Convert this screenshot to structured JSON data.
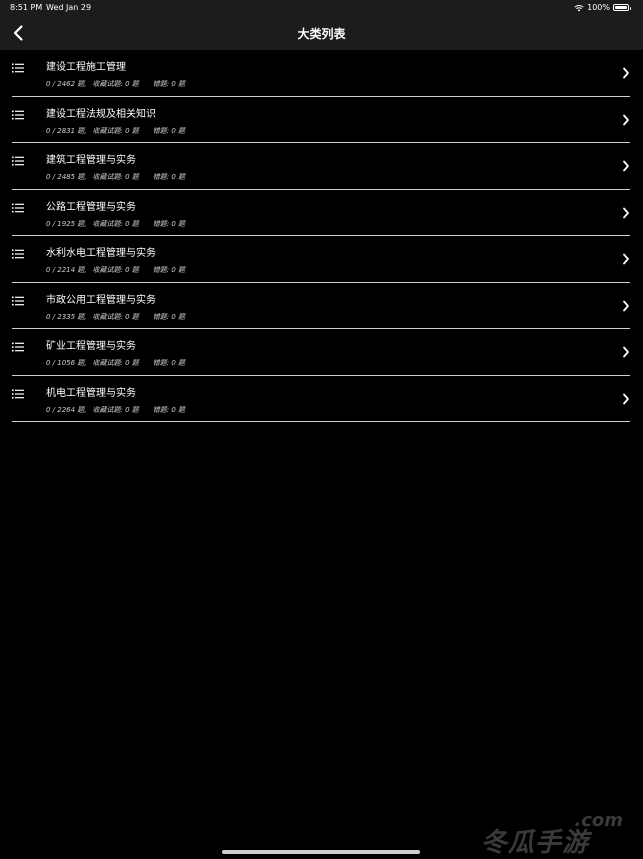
{
  "status_bar": {
    "time": "8:51 PM",
    "date": "Wed Jan 29",
    "battery": "100%"
  },
  "nav": {
    "title": "大类列表"
  },
  "items": [
    {
      "title": "建设工程施工管理",
      "progress": "0 / 2462 题,",
      "favorites": "收藏试题: 0 题",
      "errors": "错题: 0 题"
    },
    {
      "title": "建设工程法规及相关知识",
      "progress": "0 / 2831 题,",
      "favorites": "收藏试题: 0 题",
      "errors": "错题: 0 题"
    },
    {
      "title": "建筑工程管理与实务",
      "progress": "0 / 2485 题,",
      "favorites": "收藏试题: 0 题",
      "errors": "错题: 0 题"
    },
    {
      "title": "公路工程管理与实务",
      "progress": "0 / 1925 题,",
      "favorites": "收藏试题: 0 题",
      "errors": "错题: 0 题"
    },
    {
      "title": "水利水电工程管理与实务",
      "progress": "0 / 2214 题,",
      "favorites": "收藏试题: 0 题",
      "errors": "错题: 0 题"
    },
    {
      "title": "市政公用工程管理与实务",
      "progress": "0 / 2335 题,",
      "favorites": "收藏试题: 0 题",
      "errors": "错题: 0 题"
    },
    {
      "title": "矿业工程管理与实务",
      "progress": "0 / 1056 题,",
      "favorites": "收藏试题: 0 题",
      "errors": "错题: 0 题"
    },
    {
      "title": "机电工程管理与实务",
      "progress": "0 / 2264 题,",
      "favorites": "收藏试题: 0 题",
      "errors": "错题: 0 题"
    }
  ],
  "watermark": {
    "domain": ".com",
    "brand": "冬瓜手游"
  },
  "icons": {
    "back": "chevron-left-icon",
    "row_leading": "list-bullets-icon",
    "row_trailing": "chevron-right-icon",
    "wifi": "wifi-icon",
    "battery": "battery-icon"
  },
  "colors": {
    "background": "#000000",
    "bar": "#1c1c1e",
    "text": "#ffffff",
    "separator": "#cfcfcf"
  }
}
